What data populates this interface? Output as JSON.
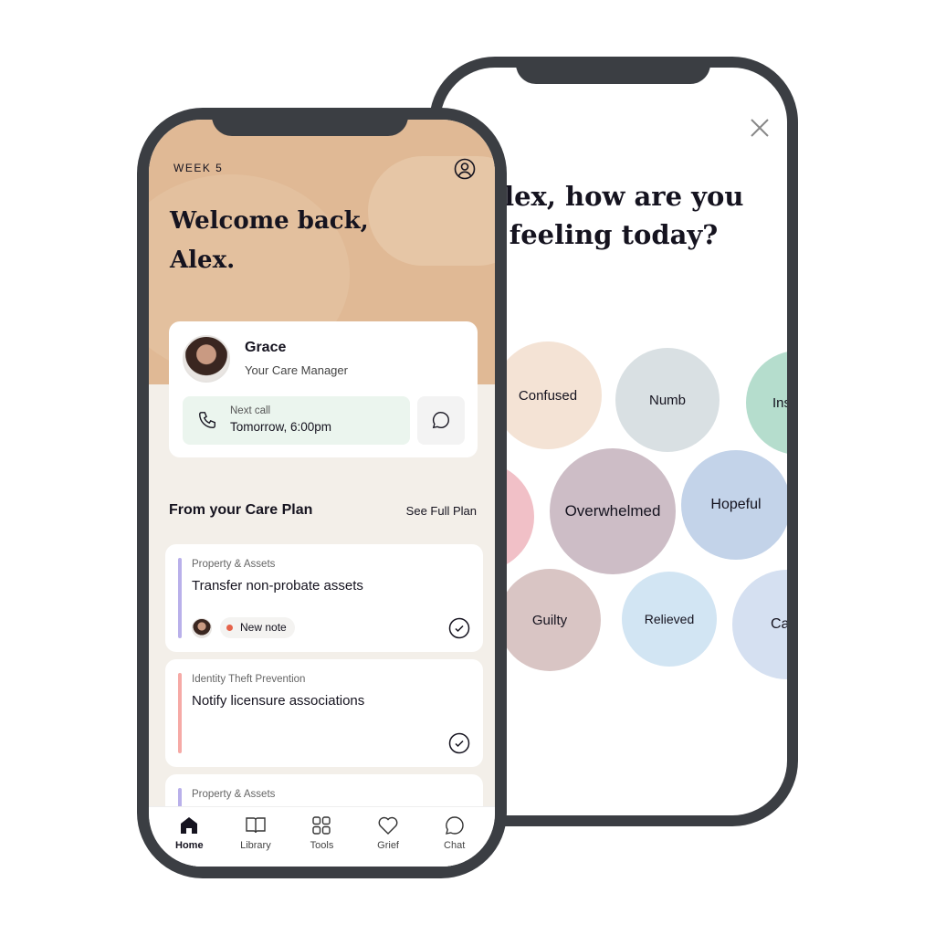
{
  "feeling_screen": {
    "question": "Alex, how are you feeling today?",
    "close_icon": "close-icon",
    "emotions": [
      {
        "label": "Confused",
        "color": "#f4e3d5"
      },
      {
        "label": "Numb",
        "color": "#d9e0e3"
      },
      {
        "label": "Ins",
        "color": "#b5ddcd"
      },
      {
        "label": "",
        "color": "#f1c0c7"
      },
      {
        "label": "Overwhelmed",
        "color": "#cdbdc6"
      },
      {
        "label": "Hopeful",
        "color": "#c3d3e9"
      },
      {
        "label": "Guilty",
        "color": "#d9c5c4"
      },
      {
        "label": "Relieved",
        "color": "#d2e5f3"
      },
      {
        "label": "Ca",
        "color": "#d5e0f1"
      }
    ]
  },
  "home_screen": {
    "week": "WEEK 5",
    "welcome_line1": "Welcome back,",
    "welcome_line2": "Alex.",
    "care_manager": {
      "name": "Grace",
      "role": "Your Care Manager",
      "next_call_label": "Next call",
      "next_call_time": "Tomorrow, 6:00pm"
    },
    "section_title": "From your Care Plan",
    "see_full_plan": "See Full Plan",
    "cards": [
      {
        "category": "Property & Assets",
        "title": "Transfer non-probate assets",
        "badge": "New note",
        "accent": "#b9b0ea"
      },
      {
        "category": "Identity Theft Prevention",
        "title": "Notify licensure associations",
        "accent": "#f6aaa6"
      },
      {
        "category": "Property & Assets",
        "accent": "#b9b0ea"
      }
    ],
    "tabs": [
      {
        "label": "Home",
        "active": true
      },
      {
        "label": "Library"
      },
      {
        "label": "Tools"
      },
      {
        "label": "Grief"
      },
      {
        "label": "Chat"
      }
    ]
  }
}
